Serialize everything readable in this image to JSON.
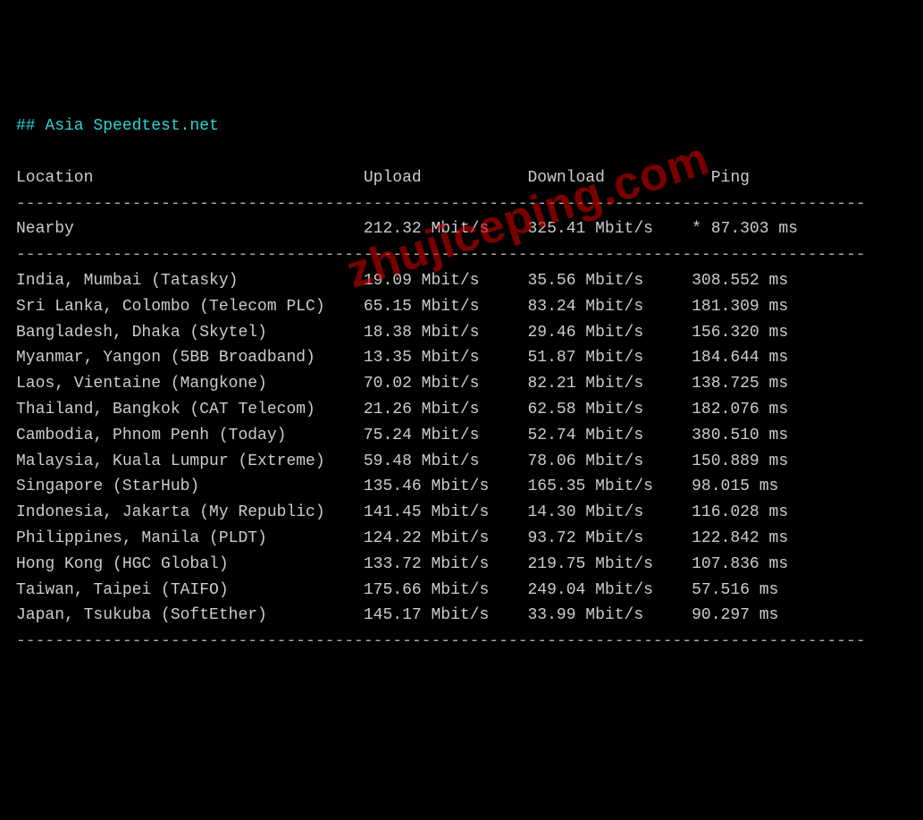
{
  "title": "## Asia Speedtest.net",
  "headers": {
    "location": "Location",
    "upload": "Upload",
    "download": "Download",
    "ping": "Ping"
  },
  "separator": "----------------------------------------------------------------------------------------",
  "nearby": {
    "location": "Nearby",
    "upload": "212.32 Mbit/s",
    "download": "325.41 Mbit/s",
    "ping": "* 87.303 ms"
  },
  "rows": [
    {
      "location": "India, Mumbai (Tatasky)",
      "upload": "19.09 Mbit/s",
      "download": "35.56 Mbit/s",
      "ping": "308.552 ms"
    },
    {
      "location": "Sri Lanka, Colombo (Telecom PLC)",
      "upload": "65.15 Mbit/s",
      "download": "83.24 Mbit/s",
      "ping": "181.309 ms"
    },
    {
      "location": "Bangladesh, Dhaka (Skytel)",
      "upload": "18.38 Mbit/s",
      "download": "29.46 Mbit/s",
      "ping": "156.320 ms"
    },
    {
      "location": "Myanmar, Yangon (5BB Broadband)",
      "upload": "13.35 Mbit/s",
      "download": "51.87 Mbit/s",
      "ping": "184.644 ms"
    },
    {
      "location": "Laos, Vientaine (Mangkone)",
      "upload": "70.02 Mbit/s",
      "download": "82.21 Mbit/s",
      "ping": "138.725 ms"
    },
    {
      "location": "Thailand, Bangkok (CAT Telecom)",
      "upload": "21.26 Mbit/s",
      "download": "62.58 Mbit/s",
      "ping": "182.076 ms"
    },
    {
      "location": "Cambodia, Phnom Penh (Today)",
      "upload": "75.24 Mbit/s",
      "download": "52.74 Mbit/s",
      "ping": "380.510 ms"
    },
    {
      "location": "Malaysia, Kuala Lumpur (Extreme)",
      "upload": "59.48 Mbit/s",
      "download": "78.06 Mbit/s",
      "ping": "150.889 ms"
    },
    {
      "location": "Singapore (StarHub)",
      "upload": "135.46 Mbit/s",
      "download": "165.35 Mbit/s",
      "ping": "98.015 ms"
    },
    {
      "location": "Indonesia, Jakarta (My Republic)",
      "upload": "141.45 Mbit/s",
      "download": "14.30 Mbit/s",
      "ping": "116.028 ms"
    },
    {
      "location": "Philippines, Manila (PLDT)",
      "upload": "124.22 Mbit/s",
      "download": "93.72 Mbit/s",
      "ping": "122.842 ms"
    },
    {
      "location": "Hong Kong (HGC Global)",
      "upload": "133.72 Mbit/s",
      "download": "219.75 Mbit/s",
      "ping": "107.836 ms"
    },
    {
      "location": "Taiwan, Taipei (TAIFO)",
      "upload": "175.66 Mbit/s",
      "download": "249.04 Mbit/s",
      "ping": "57.516 ms"
    },
    {
      "location": "Japan, Tsukuba (SoftEther)",
      "upload": "145.17 Mbit/s",
      "download": "33.99 Mbit/s",
      "ping": "90.297 ms"
    }
  ],
  "watermark": "zhujiceping.com"
}
